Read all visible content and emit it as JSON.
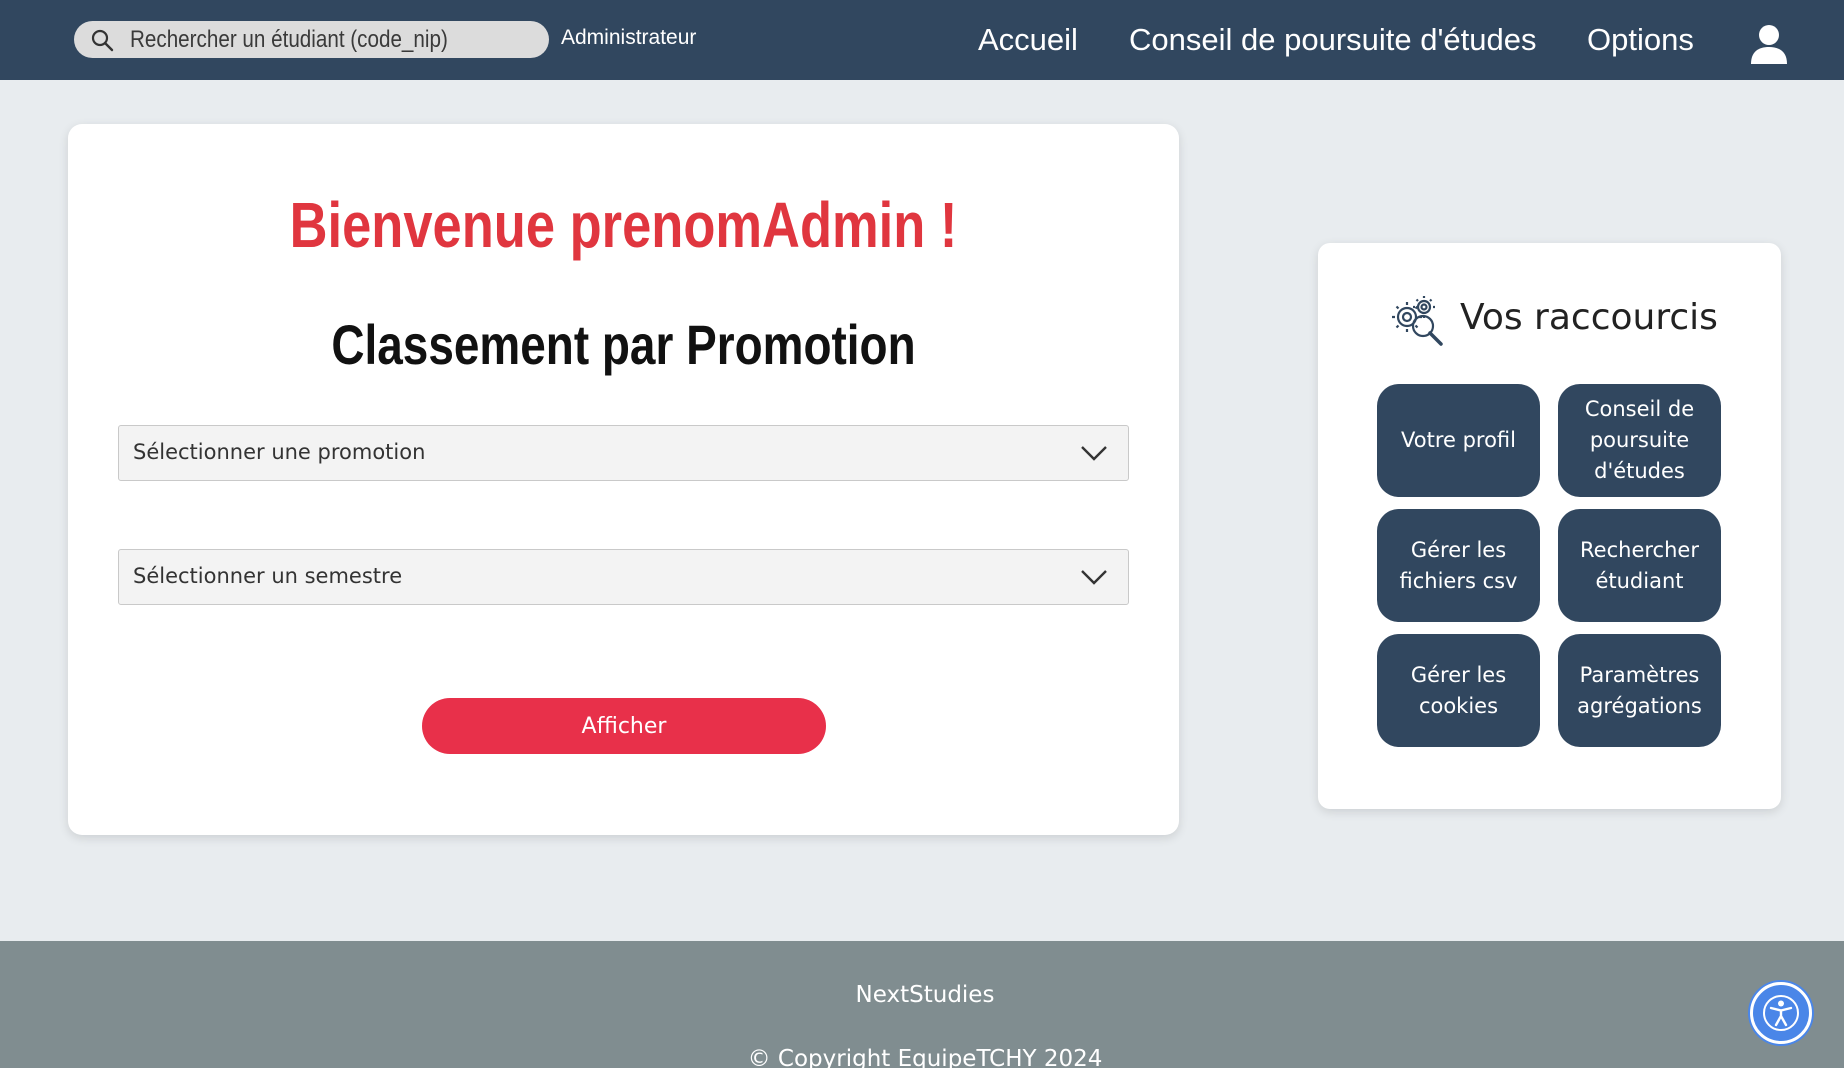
{
  "header": {
    "search": {
      "placeholder": "Rechercher un étudiant (code_nip)",
      "icon": "search-icon"
    },
    "role": "Administrateur",
    "nav": [
      {
        "label": "Accueil"
      },
      {
        "label": "Conseil de poursuite d'études"
      },
      {
        "label": "Options"
      }
    ],
    "user_icon": "user-icon"
  },
  "main": {
    "welcome": "Bienvenue prenomAdmin !",
    "title": "Classement par Promotion",
    "promotion_select": {
      "value": "Sélectionner une promotion"
    },
    "semester_select": {
      "value": "Sélectionner un semestre"
    },
    "submit_label": "Afficher"
  },
  "shortcuts": {
    "title": "Vos raccourcis",
    "icon": "gears-search-icon",
    "items": [
      {
        "label": "Votre profil"
      },
      {
        "label": "Conseil de poursuite d'études"
      },
      {
        "label": "Gérer les fichiers csv"
      },
      {
        "label": "Rechercher étudiant"
      },
      {
        "label": "Gérer les cookies"
      },
      {
        "label": "Paramètres agrégations"
      }
    ]
  },
  "footer": {
    "brand": "NextStudies",
    "copyright": "© Copyright EquipeTCHY 2024"
  },
  "accessibility": {
    "icon": "accessibility-icon"
  },
  "colors": {
    "navbar": "#31475f",
    "accent_red": "#e0363f",
    "button_red": "#e8304a",
    "shortcut_bg": "#31475f",
    "footer": "#808d90",
    "page_bg": "#e8ecef"
  }
}
